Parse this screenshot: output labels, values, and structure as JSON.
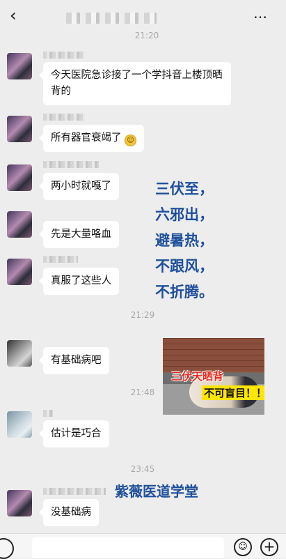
{
  "header": {
    "back_icon": "‹",
    "more_icon": "⋯"
  },
  "timestamps": [
    "21:20",
    "21:29",
    "21:48",
    "23:45"
  ],
  "messages": [
    {
      "text": "今天医院急诊接了一个学抖音上楼顶晒背的"
    },
    {
      "text": "所有器官衰竭了",
      "emoji": "sweat-smile-emoji"
    },
    {
      "text": "两小时就嘎了"
    },
    {
      "text": "先是大量咯血"
    },
    {
      "text": "真服了这些人"
    },
    {
      "text": "有基础病吧"
    },
    {
      "text": "估计是巧合"
    },
    {
      "text": "没基础病"
    }
  ],
  "overlay": {
    "lines": [
      "三伏至，",
      "六邪出，",
      "避暑热，",
      "不跟风，",
      "不折腾。"
    ],
    "color": "#1f4f9b"
  },
  "photo": {
    "caption1": "三伏天晒背",
    "caption2": "不可盲目！！",
    "caption1_color": "#e62a1f",
    "caption2_bg": "#ffe600"
  },
  "watermark": "紫薇医道学堂",
  "input_bar": {
    "emoji_icon": "☺",
    "plus_icon": "+"
  }
}
